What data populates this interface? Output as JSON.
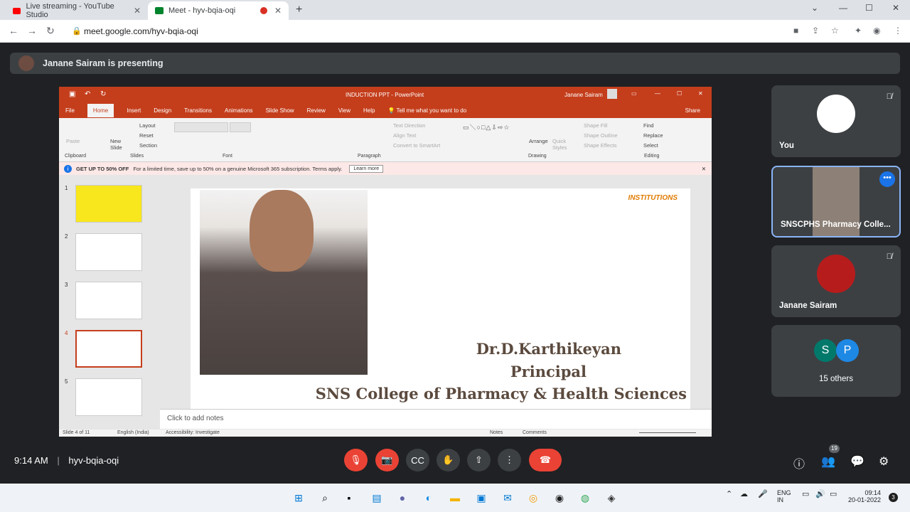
{
  "browser": {
    "tabs": [
      {
        "title": "Live streaming - YouTube Studio",
        "active": false
      },
      {
        "title": "Meet - hyv-bqia-oqi",
        "active": true
      }
    ],
    "url": "meet.google.com/hyv-bqia-oqi"
  },
  "meet": {
    "presenting_text": "Janane Sairam is presenting",
    "time": "9:14 AM",
    "meeting_code": "hyv-bqia-oqi",
    "people_count": "19",
    "participants": [
      {
        "name": "You",
        "muted": true
      },
      {
        "name": "SNSCPHS Pharmacy Colle...",
        "muted": false
      },
      {
        "name": "Janane Sairam",
        "muted": true
      },
      {
        "name": "15 others",
        "avatars": [
          "S",
          "P"
        ]
      }
    ],
    "colors": {
      "accent": "#8ab4f8",
      "end_call": "#ea4335",
      "bg": "#202124"
    }
  },
  "powerpoint": {
    "window_title": "INDUCTION PPT - PowerPoint",
    "user": "Janane Sairam",
    "menu": [
      "File",
      "Home",
      "Insert",
      "Design",
      "Transitions",
      "Animations",
      "Slide Show",
      "Review",
      "View",
      "Help"
    ],
    "tell_me": "Tell me what you want to do",
    "share": "Share",
    "groups": [
      "Clipboard",
      "Slides",
      "Font",
      "Paragraph",
      "Drawing",
      "Editing"
    ],
    "ribbon_items": {
      "layout": "Layout",
      "reset": "Reset",
      "section": "Section",
      "new_slide": "New Slide",
      "paste": "Paste",
      "text_direction": "Text Direction",
      "align_text": "Align Text",
      "convert_smartart": "Convert to SmartArt",
      "arrange": "Arrange",
      "quick_styles": "Quick Styles",
      "shape_fill": "Shape Fill",
      "shape_outline": "Shape Outline",
      "shape_effects": "Shape Effects",
      "find": "Find",
      "replace": "Replace",
      "select": "Select"
    },
    "promo": {
      "bold": "GET UP TO 50% OFF",
      "text": "For a limited time, save up to 50% on a genuine Microsoft 365 subscription. Terms apply.",
      "button": "Learn more"
    },
    "slide_numbers": [
      "1",
      "2",
      "3",
      "4",
      "5"
    ],
    "slide": {
      "name": "Dr.D.Karthikeyan",
      "role": "Principal",
      "institution": "SNS College of Pharmacy & Health Sciences",
      "logo": "INSTITUTIONS"
    },
    "notes_placeholder": "Click to add notes",
    "status": {
      "slide_count": "Slide 4 of 11",
      "language": "English (India)",
      "accessibility": "Accessibility: Investigate",
      "notes": "Notes",
      "comments": "Comments"
    }
  },
  "taskbar": {
    "lang": "ENG",
    "region": "IN",
    "clock_time": "09:14",
    "clock_date": "20-01-2022",
    "badge": "3"
  }
}
